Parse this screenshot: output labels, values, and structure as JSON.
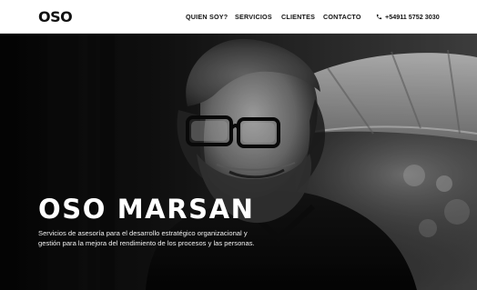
{
  "header": {
    "logo": "OSO",
    "nav": [
      {
        "label": "QUIEN SOY?"
      },
      {
        "label": "SERVICIOS"
      },
      {
        "label": "CLIENTES"
      },
      {
        "label": "CONTACTO"
      }
    ],
    "phone": "+54911 5752 3030"
  },
  "hero": {
    "title": "OSO MARSAN",
    "description": "Servicios de asesoría para el desarrollo estratégico organizacional y gestión para la mejora del rendimiento de los procesos y las personas."
  },
  "icons": {
    "phone_icon": "phone-icon"
  },
  "colors": {
    "header_bg": "#ffffff",
    "text_dark": "#111111",
    "hero_text": "#ffffff"
  }
}
